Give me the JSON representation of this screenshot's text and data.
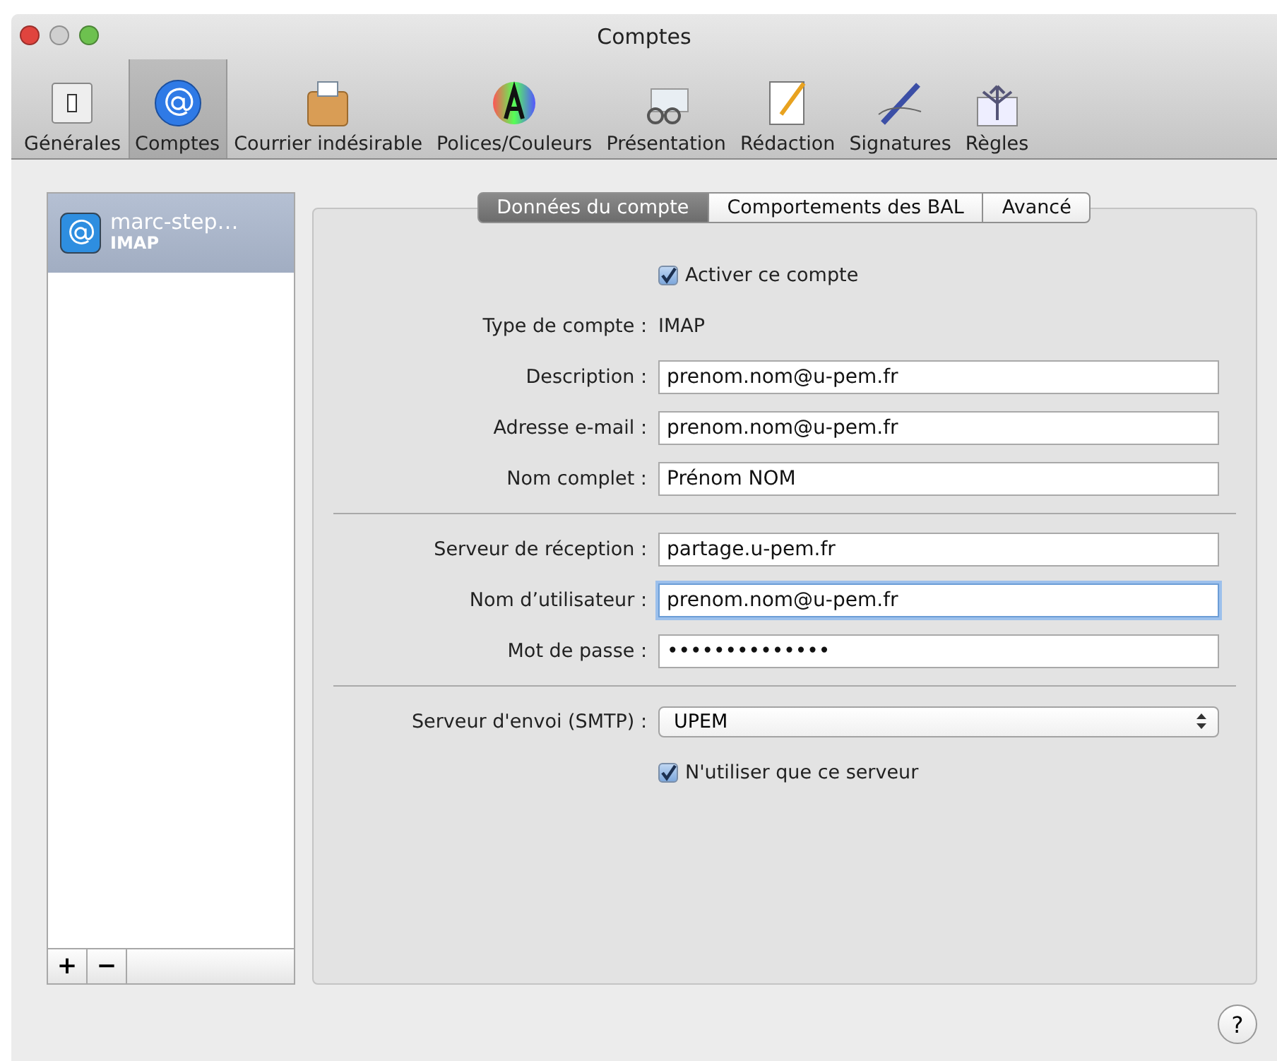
{
  "window": {
    "title": "Comptes"
  },
  "toolbar": [
    {
      "label": "Générales",
      "selected": false
    },
    {
      "label": "Comptes",
      "selected": true
    },
    {
      "label": "Courrier indésirable",
      "selected": false
    },
    {
      "label": "Polices/Couleurs",
      "selected": false
    },
    {
      "label": "Présentation",
      "selected": false
    },
    {
      "label": "Rédaction",
      "selected": false
    },
    {
      "label": "Signatures",
      "selected": false
    },
    {
      "label": "Règles",
      "selected": false
    }
  ],
  "accounts": [
    {
      "name": "marc-step…",
      "type": "IMAP",
      "selected": true
    }
  ],
  "list_buttons": [
    "+",
    "−"
  ],
  "tabs": [
    {
      "label": "Données du compte",
      "selected": true
    },
    {
      "label": "Comportements des BAL",
      "selected": false
    },
    {
      "label": "Avancé",
      "selected": false
    }
  ],
  "sections": [
    [
      {
        "kind": "checkbox",
        "label": "Activer ce compte",
        "checked": true
      },
      {
        "kind": "static",
        "label": "Type de compte :",
        "value": "IMAP"
      },
      {
        "kind": "text",
        "label": "Description :",
        "value": "prenom.nom@u-pem.fr",
        "focused": false
      },
      {
        "kind": "text",
        "label": "Adresse e-mail :",
        "value": "prenom.nom@u-pem.fr",
        "focused": false
      },
      {
        "kind": "text",
        "label": "Nom complet :",
        "value": "Prénom NOM",
        "focused": false
      }
    ],
    [
      {
        "kind": "text",
        "label": "Serveur de réception :",
        "value": "partage.u-pem.fr",
        "focused": false
      },
      {
        "kind": "text",
        "label": "Nom d’utilisateur :",
        "value": "prenom.nom@u-pem.fr",
        "focused": true
      },
      {
        "kind": "password",
        "label": "Mot de passe :",
        "value": "••••••••••••••",
        "focused": false
      }
    ],
    [
      {
        "kind": "select",
        "label": "Serveur d'envoi (SMTP) :",
        "value": "UPEM"
      },
      {
        "kind": "checkbox",
        "label": "N'utiliser que ce serveur",
        "checked": true
      }
    ]
  ],
  "help_button": "?"
}
